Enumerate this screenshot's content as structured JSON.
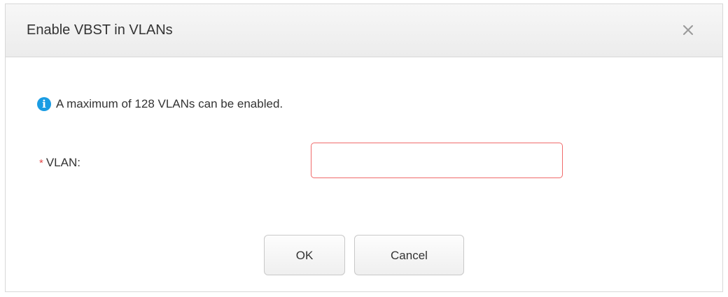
{
  "dialog": {
    "title": "Enable VBST in VLANs",
    "close_icon": "close-icon"
  },
  "info": {
    "icon": "info-icon",
    "icon_color": "#1a9ce3",
    "message": "A maximum of 128 VLANs can be enabled."
  },
  "form": {
    "vlan": {
      "required_mark": "*",
      "label": "VLAN:",
      "value": "",
      "placeholder": "",
      "error_border_color": "#f06a6a"
    }
  },
  "buttons": {
    "ok_label": "OK",
    "cancel_label": "Cancel"
  }
}
